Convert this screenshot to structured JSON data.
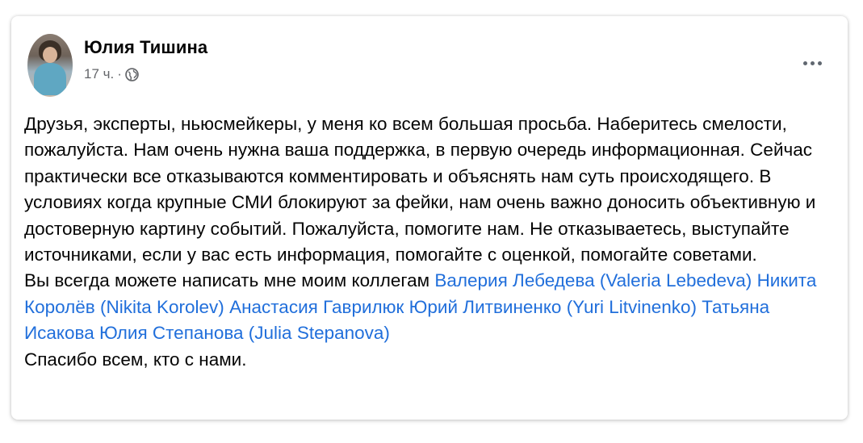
{
  "post": {
    "author": "Юлия Тишина",
    "time": "17 ч.",
    "separator": "·",
    "privacy_icon": "globe-icon",
    "more_icon": "more-options-icon",
    "paragraph1": "Друзья, эксперты, ньюсмейкеры, у меня ко всем большая просьба. Наберитесь смелости, пожалуйста. Нам очень нужна ваша поддержка, в первую очередь информационная. Сейчас практически все отказываются комментировать и объяснять нам суть происходящего. В условиях когда крупные СМИ блокируют за фейки, нам очень важно доносить объективную и достоверную картину событий. Пожалуйста, помогите нам. Не отказываетесь, выступайте источниками, если у вас есть информация, помогайте с оценкой, помогайте советами.",
    "contacts_intro": "Вы всегда можете написать мне моим коллегам",
    "tags": [
      "Валерия Лебедева (Valeria Lebedeva)",
      "Никита Королёв (Nikita Korolev)",
      "Анастасия Гаврилюк",
      "Юрий Литвиненко (Yuri Litvinenko)",
      "Татьяна Исакова",
      "Юлия Степанова (Julia Stepanova)"
    ],
    "closing": "Спасибо всем, кто с нами."
  },
  "colors": {
    "link": "#216fdb",
    "text": "#050505",
    "secondary": "#65676b"
  }
}
